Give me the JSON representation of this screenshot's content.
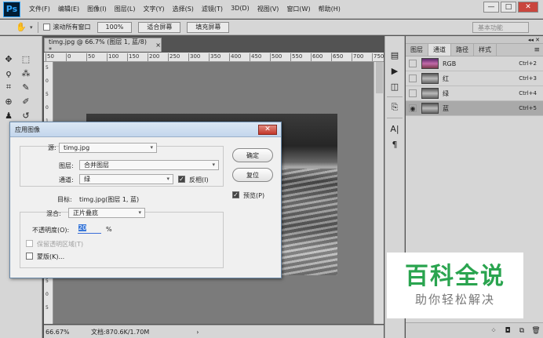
{
  "menu": {
    "logo": "Ps",
    "items": [
      "文件(F)",
      "编辑(E)",
      "图像(I)",
      "图层(L)",
      "文字(Y)",
      "选择(S)",
      "滤镜(T)",
      "3D(D)",
      "视图(V)",
      "窗口(W)",
      "帮助(H)"
    ],
    "minimize": "—",
    "maximize": "□",
    "close": "✕"
  },
  "options": {
    "scroll_all_label": "滚动所有窗口",
    "zoom_button": "100%",
    "fit_screen": "适合屏幕",
    "fill_screen": "填充屏幕",
    "workspace": "基本功能"
  },
  "document": {
    "tab_title": "timg.jpg @ 66.7% (图层 1, 蓝/8) *",
    "tab_close": "×",
    "ruler_ticks": [
      "50",
      "0",
      "50",
      "100",
      "150",
      "200",
      "250",
      "300",
      "350",
      "400",
      "450",
      "500",
      "550",
      "600",
      "650",
      "700",
      "750"
    ],
    "ruler_v_ticks": [
      "5",
      "0",
      "5",
      "0",
      "1",
      "0",
      "1",
      "5",
      "0",
      "2",
      "5",
      "0",
      "3",
      "5",
      "0",
      "4",
      "5",
      "0",
      "5"
    ],
    "zoom": "66.67%",
    "doc_size": "文档:870.6K/1.70M",
    "status_arrow": "›"
  },
  "channels": {
    "tabs": [
      "图层",
      "通道",
      "路径",
      "样式"
    ],
    "active_tab": 1,
    "menu_icon": "≡",
    "top_arrows": "◂◂ ✕",
    "rows": [
      {
        "name": "RGB",
        "shortcut": "Ctrl+2",
        "selected": false,
        "thumb": "rgb"
      },
      {
        "name": "红",
        "shortcut": "Ctrl+3",
        "selected": false,
        "thumb": "gray"
      },
      {
        "name": "绿",
        "shortcut": "Ctrl+4",
        "selected": false,
        "thumb": "gray"
      },
      {
        "name": "蓝",
        "shortcut": "Ctrl+5",
        "selected": true,
        "thumb": "gray"
      }
    ]
  },
  "watermark": {
    "main": "百科全说",
    "sub": "助你轻松解决"
  },
  "dialog": {
    "title": "应用图像",
    "close": "✕",
    "source_label": "源:",
    "source_value": "timg.jpg",
    "layer_label": "图层:",
    "layer_value": "合并图层",
    "channel_label": "通道:",
    "channel_value": "绿",
    "invert_label": "反相(I)",
    "invert_checked": true,
    "target_label": "目标:",
    "target_value": "timg.jpg(图层 1, 蓝)",
    "blend_label": "混合:",
    "blend_value": "正片叠底",
    "opacity_label": "不透明度(O):",
    "opacity_value": "20",
    "opacity_unit": "%",
    "preserve_label": "保留透明区域(T)",
    "mask_label": "蒙版(K)...",
    "ok_button": "确定",
    "reset_button": "复位",
    "preview_label": "预览(P)",
    "preview_checked": true
  }
}
